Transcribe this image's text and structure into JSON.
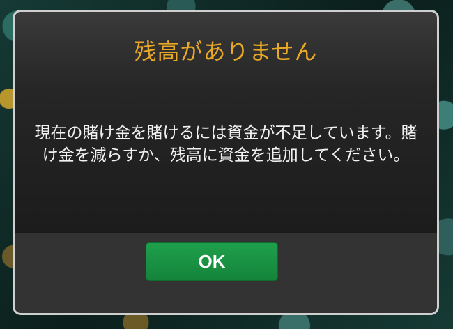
{
  "dialog": {
    "title": "残高がありません",
    "message": "現在の賭け金を賭けるには資金が不足しています。賭け金を減らすか、残高に資金を追加してください。",
    "ok_label": "OK"
  },
  "colors": {
    "title": "#e9a825",
    "button": "#1a9444",
    "dialog_background": "#1e1e1e"
  }
}
